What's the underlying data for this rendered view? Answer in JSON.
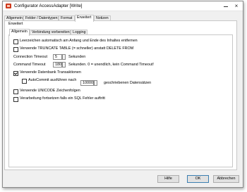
{
  "window": {
    "title": "Configurator AccessAdapter [Write]",
    "minimize_glyph": "",
    "close_glyph": "×"
  },
  "tabs": [
    {
      "label": "Allgemein"
    },
    {
      "label": "Felder / Datentypen"
    },
    {
      "label": "Format"
    },
    {
      "label": "Erweitert",
      "active": true
    },
    {
      "label": "Notizen"
    }
  ],
  "group_label": "Erweitert",
  "subtabs": [
    {
      "label": "Allgemein",
      "active": true
    },
    {
      "label": "Verbindung vorbereiten"
    },
    {
      "label": "Logging"
    }
  ],
  "options": {
    "trim_whitespace": {
      "label": "Leerzeichen automatisch am Anfang und Ende des Inhaltes entfernen",
      "checked": false
    },
    "truncate_table": {
      "label": "Verwende TRUNCATE TABLE (= schneller) anstatt DELETE FROM",
      "checked": false
    },
    "connection_timeout": {
      "label": "Connection Timeout",
      "value": "5",
      "unit": "Sekunden"
    },
    "command_timeout": {
      "label": "Command Timeout",
      "value": "180",
      "unit": "Sekunden. 0 = unendlich, kein Command Timeout!"
    },
    "transactions": {
      "label": "Verwende Datenbank Transaktionen",
      "checked": true
    },
    "autocommit": {
      "label": "AutoCommit ausführen nach",
      "checked": false,
      "value": "10000",
      "unit": "geschriebenen Datensätzen"
    },
    "unicode": {
      "label": "Verwende UNICODE Zeichenfolgen",
      "checked": false
    },
    "continue_on_error": {
      "label": "Verarbeitung fortsetzen falls ein SQL Fehler auftritt",
      "checked": false
    }
  },
  "buttons": {
    "help": "Hilfe",
    "ok": "OK",
    "cancel": "Abbrechen"
  }
}
